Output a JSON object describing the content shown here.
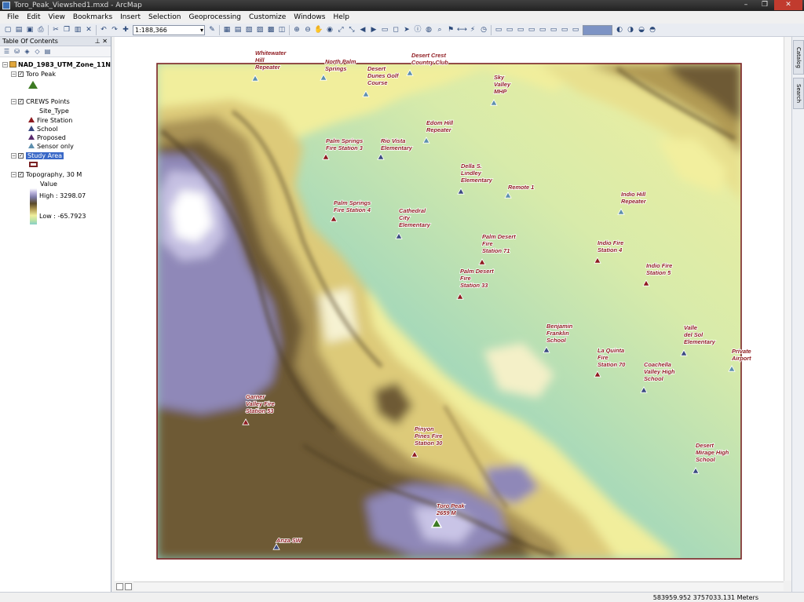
{
  "window": {
    "title": "Toro_Peak_Viewshed1.mxd - ArcMap",
    "buttons": [
      "–",
      "❐",
      "✕"
    ]
  },
  "menu": [
    "File",
    "Edit",
    "View",
    "Bookmarks",
    "Insert",
    "Selection",
    "Geoprocessing",
    "Customize",
    "Windows",
    "Help"
  ],
  "toolbar": {
    "scale": "1:188,366"
  },
  "toc": {
    "title": "Table Of Contents",
    "dataframe": "NAD_1983_UTM_Zone_11N",
    "layers": [
      {
        "name": "Toro Peak"
      },
      {
        "name": "CREWS Points",
        "field": "Site_Type",
        "classes": [
          "Fire Station",
          "School",
          "Proposed",
          "Sensor only"
        ]
      },
      {
        "name": "Study Area"
      },
      {
        "name": "Topography, 30 M",
        "field": "Value",
        "high": "High : 3298.07",
        "low": "Low : -65.7923"
      }
    ]
  },
  "colors": {
    "fire_station": "#8e1a1f",
    "school": "#3b4a82",
    "proposed": "#5a2b6e",
    "sensor_only": "#5d8fae",
    "study_area": "#7a2224",
    "toro_peak": "#3d7a23"
  },
  "map": {
    "points": [
      {
        "label": "Whitewater Hill Repeater",
        "type": "sensor_only"
      },
      {
        "label": "North Palm Springs",
        "type": "sensor_only"
      },
      {
        "label": "Desert Crest Country Club",
        "type": "sensor_only"
      },
      {
        "label": "Desert Dunes Golf Course",
        "type": "sensor_only"
      },
      {
        "label": "Sky Valley MHP",
        "type": "sensor_only"
      },
      {
        "label": "Edom Hill Repeater",
        "type": "sensor_only"
      },
      {
        "label": "Palm Springs Fire Station 3",
        "type": "fire_station"
      },
      {
        "label": "Rio Vista Elementary",
        "type": "school"
      },
      {
        "label": "Della S. Lindley Elementary",
        "type": "school"
      },
      {
        "label": "Remote 1",
        "type": "sensor_only"
      },
      {
        "label": "Indio Hill Repeater",
        "type": "sensor_only"
      },
      {
        "label": "Palm Springs Fire Station 4",
        "type": "fire_station"
      },
      {
        "label": "Cathedral City Elementary",
        "type": "school"
      },
      {
        "label": "Palm Desert Fire Station 71",
        "type": "fire_station"
      },
      {
        "label": "Indio Fire Station 4",
        "type": "fire_station"
      },
      {
        "label": "Indio Fire Station 5",
        "type": "fire_station"
      },
      {
        "label": "Palm Desert Fire Station 33",
        "type": "fire_station"
      },
      {
        "label": "Benjamin Franklin School",
        "type": "school"
      },
      {
        "label": "Valle del Sol Elementary",
        "type": "school"
      },
      {
        "label": "Private Airport",
        "type": "sensor_only"
      },
      {
        "label": "La Quinta Fire Station 70",
        "type": "fire_station"
      },
      {
        "label": "Coachella Valley High School",
        "type": "school"
      },
      {
        "label": "Garner Valley Fire Station 53",
        "type": "fire_station"
      },
      {
        "label": "Pinyon Pines Fire Station 30",
        "type": "fire_station"
      },
      {
        "label": "Desert Mirage High School",
        "type": "school"
      },
      {
        "label": "Toro Peak 2659 M",
        "type": "toro_peak"
      },
      {
        "label": "Anza SW",
        "type": "school"
      }
    ]
  },
  "dock_tabs": [
    "Catalog",
    "Search"
  ],
  "status": {
    "coords": "583959.952  3757033.131 Meters"
  }
}
